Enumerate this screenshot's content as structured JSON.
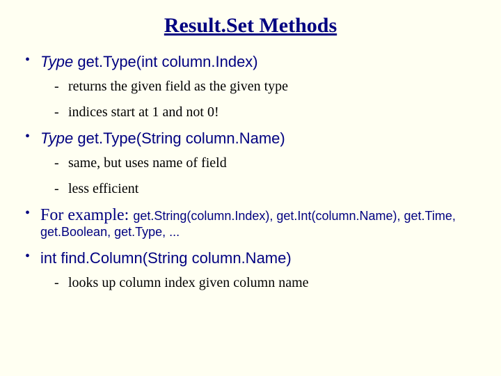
{
  "title": "Result.Set Methods",
  "b0": {
    "prefix_italic": "Type",
    "signature": " get.Type(int column.Index)",
    "s0": "returns the given field as the given type",
    "s1": "indices start at 1 and not 0!"
  },
  "b1": {
    "prefix_italic": "Type",
    "signature": " get.Type(String column.Name)",
    "s0": "same, but uses name of field",
    "s1": "less efficient"
  },
  "b2": {
    "lead": "For example: ",
    "examples": "get.String(column.Index), get.Int(column.Name), get.Time, get.Boolean, get.Type, ..."
  },
  "b3": {
    "signature": "int find.Column(String column.Name)",
    "s0": "looks up column index given column name"
  }
}
